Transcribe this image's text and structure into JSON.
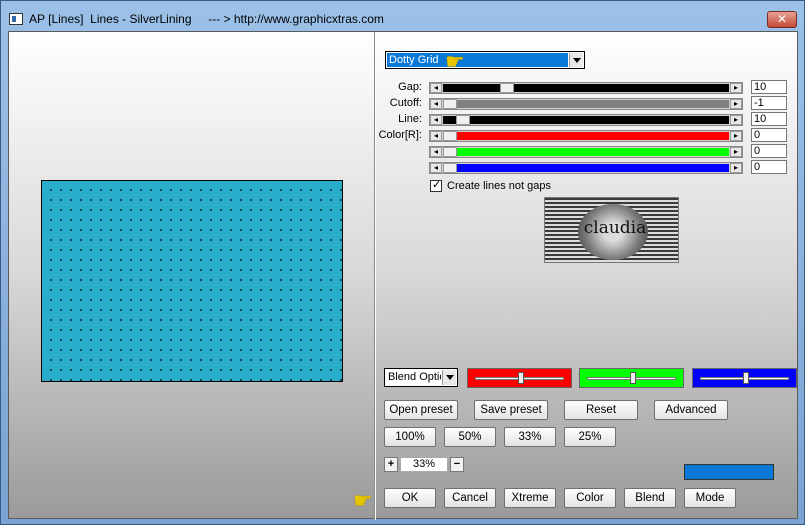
{
  "window": {
    "title": "AP [Lines]  Lines - SilverLining     --- > http://www.graphicxtras.com",
    "close_label": "✕"
  },
  "effect": {
    "selected": "Dotty Grid"
  },
  "sliders": [
    {
      "label": "Gap:",
      "value": "10",
      "color": "#000000",
      "pos": 0.22
    },
    {
      "label": "Cutoff:",
      "value": "-1",
      "color": "#808080",
      "pos": 0.0
    },
    {
      "label": "Line:",
      "value": "10",
      "color": "#000000",
      "pos": 0.05
    },
    {
      "label": "Color[R]:",
      "value": "0",
      "color": "#ff0000",
      "pos": 0.0
    },
    {
      "label": "",
      "value": "0",
      "color": "#00ff00",
      "pos": 0.0
    },
    {
      "label": "",
      "value": "0",
      "color": "#0000ff",
      "pos": 0.0
    }
  ],
  "checkbox": {
    "label": "Create lines not gaps",
    "checked": true
  },
  "logo": {
    "text": "claudia"
  },
  "blend": {
    "selected": "Blend Optio",
    "sliders": [
      {
        "color": "#ff0000",
        "pos": 0.5
      },
      {
        "color": "#00ff00",
        "pos": 0.5
      },
      {
        "color": "#0000ff",
        "pos": 0.5
      }
    ]
  },
  "preset_buttons": {
    "open": "Open preset",
    "save": "Save preset",
    "reset": "Reset",
    "advanced": "Advanced"
  },
  "zoom_buttons": {
    "z100": "100%",
    "z50": "50%",
    "z33": "33%",
    "z25": "25%"
  },
  "zoom": {
    "plus": "+",
    "value": "33%",
    "minus": "−"
  },
  "action_buttons": {
    "ok": "OK",
    "cancel": "Cancel",
    "xtreme": "Xtreme",
    "color": "Color",
    "blend": "Blend",
    "mode": "Mode"
  },
  "colors": {
    "swatch": "#0a78d7",
    "preview": "#2aaccb"
  },
  "icons": {
    "pointer": "pointing-hand-icon"
  }
}
